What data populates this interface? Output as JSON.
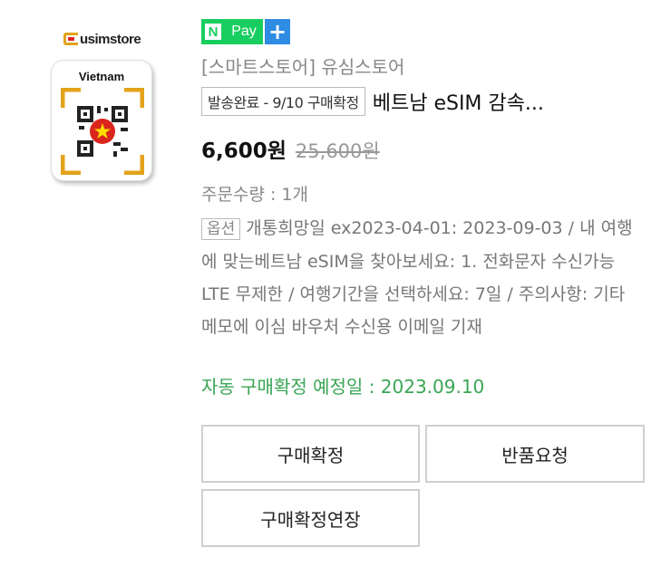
{
  "thumbnail": {
    "store_logo_text": "usimstore",
    "country": "Vietnam"
  },
  "npay": {
    "n": "N",
    "pay": "Pay",
    "plus": "+"
  },
  "colors": {
    "npay_green": "#19ce60",
    "npay_plus_blue": "#2e8ce5",
    "confirm_green": "#3aa655"
  },
  "order": {
    "store_name": "[스마트스토어] 유심스토어",
    "status_badge": "발송완료 - 9/10 구매확정",
    "product_title": "베트남 eSIM 감속...",
    "price": "6,600원",
    "original_price": "25,600원",
    "quantity": "주문수량 : 1개",
    "option_badge": "옵션",
    "option_text": "개통희망일 ex2023-04-01: 2023-09-03 / 내 여행에 맞는베트남 eSIM을 찾아보세요: 1. 전화문자 수신가능 LTE 무제한 / 여행기간을 선택하세요: 7일 / 주의사항: 기타 메모에 이심 바우처 수신용 이메일 기재",
    "auto_confirm": "자동 구매확정 예정일 : 2023.09.10"
  },
  "buttons": {
    "confirm": "구매확정",
    "return": "반품요청",
    "extend": "구매확정연장"
  }
}
